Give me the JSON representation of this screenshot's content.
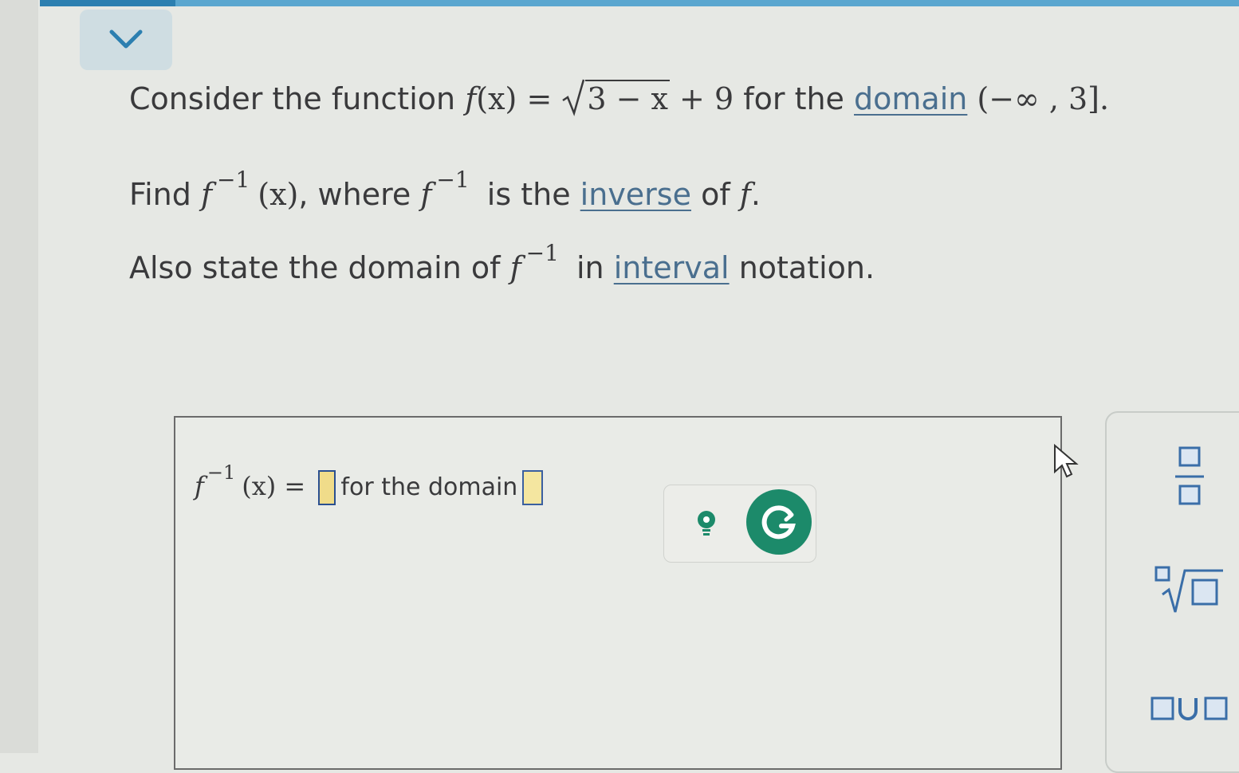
{
  "question": {
    "line1": {
      "prefix": "Consider the function ",
      "fname": "f",
      "arg": "(x)",
      "eq": " = ",
      "radicand": "3 − x",
      "plus": " + 9",
      "mid": " for the ",
      "link": "domain",
      "interval": " (−∞ , 3]."
    },
    "line2": {
      "prefix": "Find ",
      "fname": "f",
      "sup": "−1",
      "arg": "(x)",
      "mid1": ", where ",
      "fname2": "f",
      "sup2": "−1",
      "mid2": " is the ",
      "link": "inverse",
      "of": " of ",
      "fname3": "f",
      "end": "."
    },
    "line3": {
      "prefix": "Also state the domain of ",
      "fname": "f",
      "sup": "−1",
      "mid": " in ",
      "link": "interval",
      "end": " notation."
    }
  },
  "answer": {
    "fname": "f",
    "sup": "−1",
    "arg": "(x)",
    "eq": " = ",
    "domain_label": "for the domain"
  },
  "palette": {
    "buttons": [
      "fraction-icon",
      "nth-root-icon",
      "union-icon"
    ]
  },
  "colors": {
    "link": "#4a6f8f",
    "slot_border": "#3a5fa0",
    "slot_fill": "#f4e6a0",
    "grammarly": "#1c8a6a",
    "topbar": "#5aa6cf"
  }
}
